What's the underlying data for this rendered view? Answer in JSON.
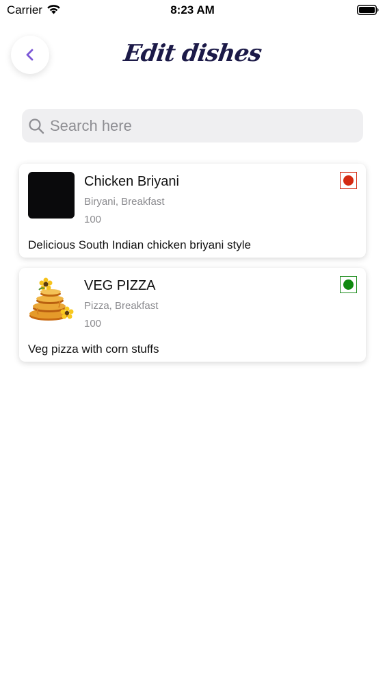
{
  "status_bar": {
    "carrier": "Carrier",
    "time": "8:23 AM",
    "wifi_icon": "wifi-icon",
    "battery_icon": "battery-icon"
  },
  "header": {
    "back_icon": "chevron-left-icon",
    "title": "Edit dishes",
    "accent_color": "#7b57d6",
    "title_color": "#1c1a48"
  },
  "search": {
    "placeholder": "Search here",
    "value": "",
    "icon": "search-icon"
  },
  "dishes": [
    {
      "name": "Chicken Briyani",
      "category": "Biryani, Breakfast",
      "price": "100",
      "description": "Delicious South Indian chicken briyani style",
      "type": "non-veg",
      "indicator_color": "#d42a12",
      "image": "black-placeholder"
    },
    {
      "name": "VEG PIZZA",
      "category": "Pizza, Breakfast",
      "price": "100",
      "description": "Veg pizza with corn stuffs",
      "type": "veg",
      "indicator_color": "#1a8a1a",
      "image": "honey-stack-with-flowers"
    }
  ]
}
